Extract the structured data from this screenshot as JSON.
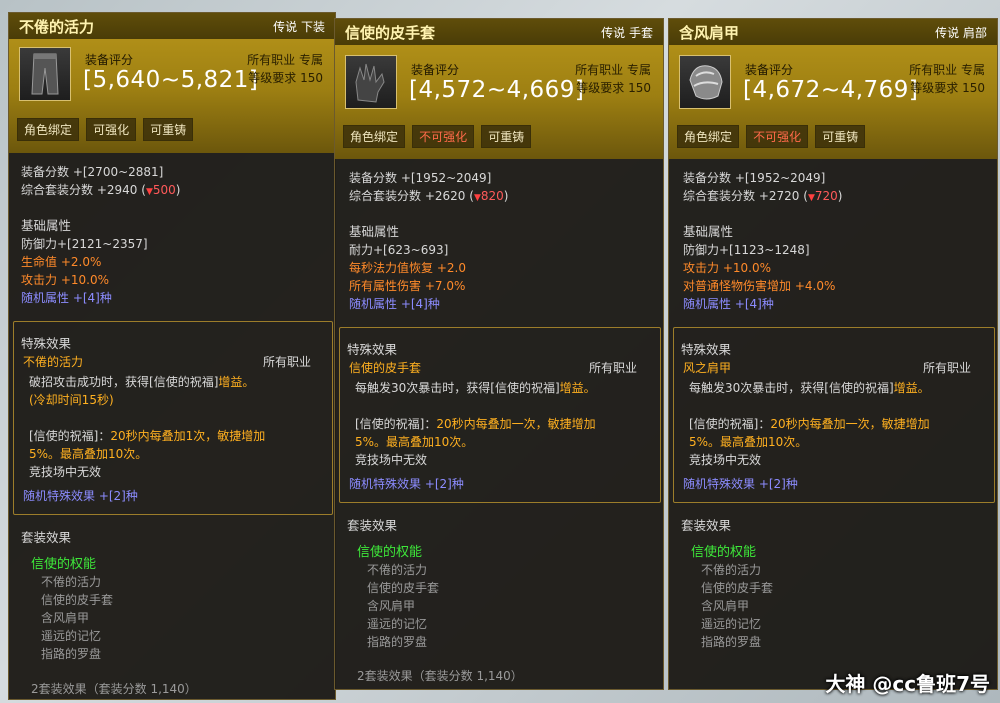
{
  "panels": [
    {
      "title": "不倦的活力",
      "tag": "传说 下装",
      "icon": "pants-icon",
      "score_label": "装备评分",
      "score": "[5,640~5,821]",
      "job": "所有职业 专属",
      "level": "等级要求 150",
      "buttons": [
        "角色绑定",
        "可强化",
        "可重铸"
      ],
      "equip_score": "装备分数 +[2700~2881]",
      "set_score": "综合套装分数 +2940",
      "set_score_down": "500",
      "base_title": "基础属性",
      "base_attrs": [
        "防御力+[2121~2357]",
        "生命值 +2.0%",
        "攻击力 +10.0%",
        "随机属性 +[4]种"
      ],
      "special_title": "特殊效果",
      "special_name": "不倦的活力",
      "special_job": "所有职业",
      "special_lines": [
        "破招攻击成功时，获得",
        "[信使的祝福]",
        "增益。",
        "(冷却时间15秒)"
      ],
      "buff_lines": [
        "[信使的祝福]：",
        "20秒内每叠加1次，敏捷增加",
        "5%。最高叠加10次。",
        "竞技场中无效"
      ],
      "random_special": "随机特殊效果 +[2]种",
      "set_title": "套装效果",
      "set_name": "信使的权能",
      "set_items": [
        "不倦的活力",
        "信使的皮手套",
        "含风肩甲",
        "遥远的记忆",
        "指路的罗盘"
      ],
      "set_effect": "2套装效果（套装分数 1,140）"
    },
    {
      "title": "信使的皮手套",
      "tag": "传说 手套",
      "icon": "glove-icon",
      "score_label": "装备评分",
      "score": "[4,572~4,669]",
      "job": "所有职业 专属",
      "level": "等级要求 150",
      "buttons": [
        "角色绑定",
        "不可强化",
        "可重铸"
      ],
      "equip_score": "装备分数 +[1952~2049]",
      "set_score": "综合套装分数 +2620",
      "set_score_down": "820",
      "base_title": "基础属性",
      "base_attrs": [
        "耐力+[623~693]",
        "每秒法力值恢复 +2.0",
        "所有属性伤害 +7.0%",
        "随机属性 +[4]种"
      ],
      "special_title": "特殊效果",
      "special_name": "信使的皮手套",
      "special_job": "所有职业",
      "special_lines": [
        "每触发30次暴击时，获得",
        "[信使的祝福]",
        "增益。",
        ""
      ],
      "buff_lines": [
        "[信使的祝福]：",
        "20秒内每叠加一次，敏捷增加",
        "5%。最高叠加10次。",
        "竞技场中无效"
      ],
      "random_special": "随机特殊效果 +[2]种",
      "set_title": "套装效果",
      "set_name": "信使的权能",
      "set_items": [
        "不倦的活力",
        "信使的皮手套",
        "含风肩甲",
        "遥远的记忆",
        "指路的罗盘"
      ],
      "set_effect": "2套装效果（套装分数 1,140）"
    },
    {
      "title": "含风肩甲",
      "tag": "传说 肩部",
      "icon": "shoulder-armor-icon",
      "score_label": "装备评分",
      "score": "[4,672~4,769]",
      "job": "所有职业 专属",
      "level": "等级要求 150",
      "buttons": [
        "角色绑定",
        "不可强化",
        "可重铸"
      ],
      "equip_score": "装备分数 +[1952~2049]",
      "set_score": "综合套装分数 +2720",
      "set_score_down": "720",
      "base_title": "基础属性",
      "base_attrs": [
        "防御力+[1123~1248]",
        "攻击力 +10.0%",
        "对普通怪物伤害增加 +4.0%",
        "随机属性 +[4]种"
      ],
      "special_title": "特殊效果",
      "special_name": "风之肩甲",
      "special_job": "所有职业",
      "special_lines": [
        "每触发30次暴击时，获得",
        "[信使的祝福]",
        "增益。",
        ""
      ],
      "buff_lines": [
        "[信使的祝福]：",
        "20秒内每叠加一次，敏捷增加",
        "5%。最高叠加10次。",
        "竞技场中无效"
      ],
      "random_special": "随机特殊效果 +[2]种",
      "set_title": "套装效果",
      "set_name": "信使的权能",
      "set_items": [
        "不倦的活力",
        "信使的皮手套",
        "含风肩甲",
        "遥远的记忆",
        "指路的罗盘"
      ],
      "set_effect": ""
    }
  ],
  "watermark": "大神 @cc鲁班7号"
}
